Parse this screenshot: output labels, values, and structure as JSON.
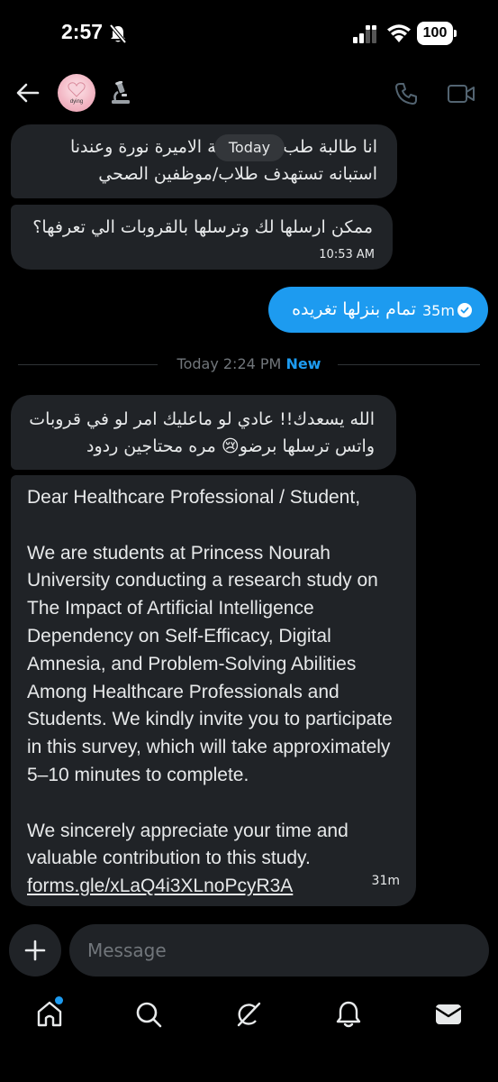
{
  "status": {
    "time": "2:57",
    "battery": "100"
  },
  "header": {
    "avatar_label": "dying"
  },
  "messages": {
    "m1_text": "انا طالبة طب في جامعة الاميرة نورة وعندنا استبانه تستهدف طلاب/موظفين الصحي",
    "today_pill": "Today",
    "m2_text": "ممكن ارسلها لك وترسلها بالقروبات الي تعرفها؟",
    "m2_time": "10:53 AM",
    "sent_text": "تمام بنزلها تغريده",
    "sent_time": "35m",
    "divider_text": "Today 2:24 PM",
    "divider_new": "New",
    "m3_text": "الله يسعدك!! عادي لو ماعليك امر لو في قروبات واتس ترسلها برضو😢 مره محتاجين ردود",
    "m4_greeting": "Dear Healthcare Professional / Student,",
    "m4_body": "We are students at Princess Nourah University conducting a research study on The Impact of Artificial Intelligence Dependency on Self-Efficacy, Digital Amnesia, and Problem-Solving Abilities Among Healthcare Professionals and Students. We kindly invite you to participate in this survey, which will take approximately 5–10 minutes to complete.",
    "m4_thanks": "We sincerely appreciate your time and valuable contribution to this study.",
    "m4_link": "forms.gle/xLaQ4i3XLnoPcyR3A",
    "m4_time": "31m"
  },
  "composer": {
    "placeholder": "Message"
  },
  "colors": {
    "accent": "#1d9bf0",
    "bubble": "#202327",
    "background": "#000000",
    "muted": "#71767b"
  },
  "icons": {
    "bottom_nav": [
      "home-icon",
      "search-icon",
      "grok-icon",
      "notifications-icon",
      "messages-icon"
    ]
  }
}
